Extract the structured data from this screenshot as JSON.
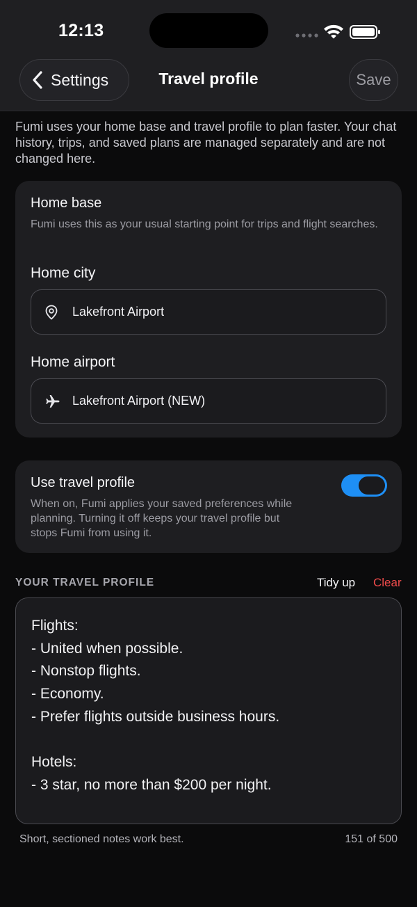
{
  "status_bar": {
    "time": "12:13",
    "icons": [
      "signal-dots-icon",
      "wifi-icon",
      "battery-icon"
    ]
  },
  "nav": {
    "back_label": "Settings",
    "title": "Travel profile",
    "save_label": "Save"
  },
  "intro": "Fumi uses your home base and travel profile to plan faster. Your chat history, trips, and saved plans are managed separately and are not changed here.",
  "home_base": {
    "title": "Home base",
    "subtitle": "Fumi uses this as your usual starting point for trips and flight searches.",
    "city_label": "Home city",
    "city_value": "Lakefront Airport",
    "airport_label": "Home airport",
    "airport_value": "Lakefront Airport (NEW)"
  },
  "travel_toggle": {
    "title": "Use travel profile",
    "subtitle": "When on, Fumi applies your saved preferences while planning. Turning it off keeps your travel profile but stops Fumi from using it.",
    "on": true
  },
  "profile": {
    "section_label": "YOUR TRAVEL PROFILE",
    "tidy_label": "Tidy up",
    "clear_label": "Clear",
    "lines": [
      "Flights:",
      "- United when possible.",
      "- Nonstop flights.",
      "- Economy.",
      "- Prefer flights outside business hours.",
      "",
      "Hotels:",
      "- 3 star, no more than $200 per night."
    ],
    "hint": "Short, sectioned notes work best.",
    "count": "151 of 500"
  },
  "colors": {
    "accent": "#1e8ff5",
    "danger": "#ef4b4b",
    "background": "#0b0b0c",
    "card": "#1e1e21"
  }
}
